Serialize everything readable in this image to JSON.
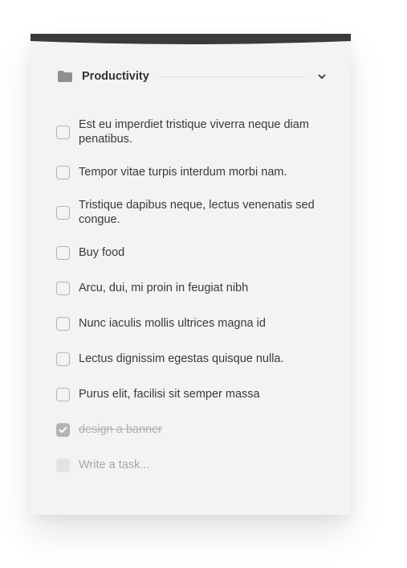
{
  "category": {
    "title": "Productivity",
    "folder_icon": "folder-icon",
    "toggle_icon": "chevron-down-icon"
  },
  "tasks": [
    {
      "text": "Est eu imperdiet tristique viverra neque diam penatibus.",
      "done": false
    },
    {
      "text": "Tempor vitae turpis interdum morbi nam.",
      "done": false
    },
    {
      "text": "Tristique dapibus neque, lectus venenatis sed congue.",
      "done": false
    },
    {
      "text": "Buy food",
      "done": false
    },
    {
      "text": "Arcu, dui, mi proin in feugiat nibh",
      "done": false
    },
    {
      "text": "Nunc iaculis mollis ultrices magna id",
      "done": false
    },
    {
      "text": "Lectus dignissim egestas quisque nulla.",
      "done": false
    },
    {
      "text": "Purus elit, facilisi sit semper massa",
      "done": false
    },
    {
      "text": "design a banner",
      "done": true
    }
  ],
  "new_task": {
    "placeholder": "Write a task..."
  },
  "colors": {
    "card": "#f3f3f3",
    "topbar": "#3a3a3a",
    "checkbox_border": "#b4b4b4",
    "checked_fill": "#b3b3b3"
  }
}
